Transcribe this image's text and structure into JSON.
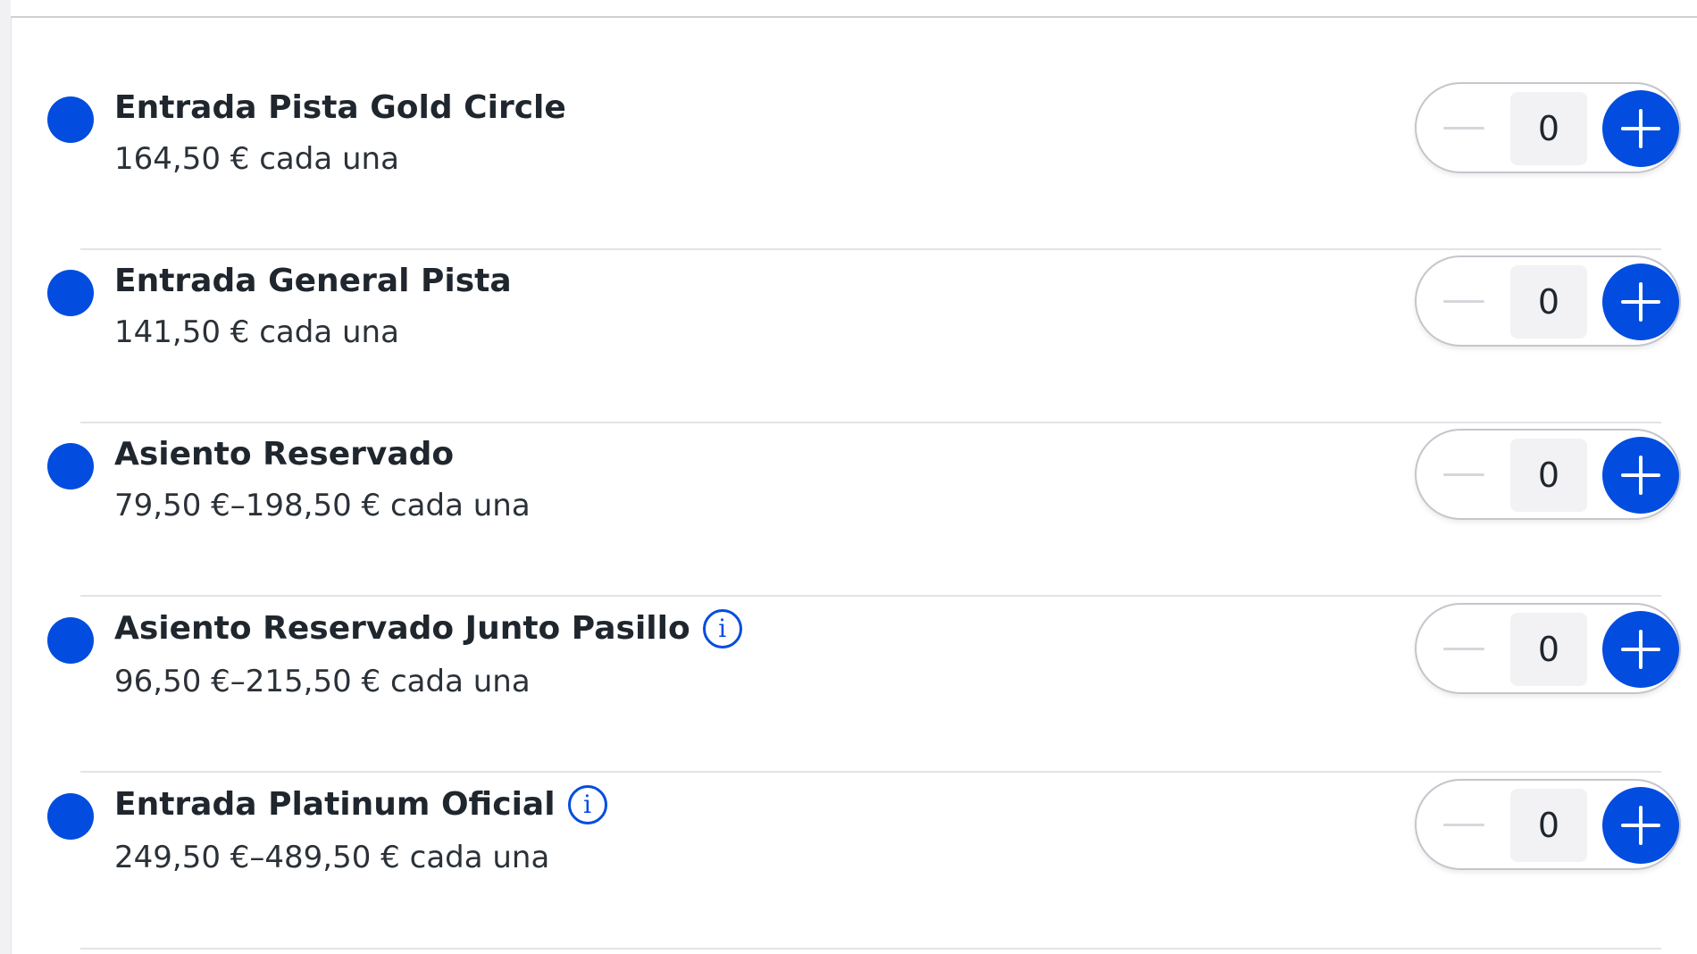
{
  "tickets": [
    {
      "name": "Entrada Pista Gold Circle",
      "price": "164,50 € cada una",
      "quantity": "0",
      "has_info": false
    },
    {
      "name": "Entrada General Pista",
      "price": "141,50 € cada una",
      "quantity": "0",
      "has_info": false
    },
    {
      "name": "Asiento Reservado",
      "price": "79,50 €–198,50 € cada una",
      "quantity": "0",
      "has_info": false
    },
    {
      "name": "Asiento Reservado Junto Pasillo",
      "price": "96,50 €–215,50 € cada una",
      "quantity": "0",
      "has_info": true
    },
    {
      "name": "Entrada Platinum Oficial",
      "price": "249,50 €–489,50 € cada una",
      "quantity": "0",
      "has_info": true
    }
  ],
  "colors": {
    "accent": "#024ddf",
    "text": "#1f262d",
    "divider": "#e3e3e8"
  },
  "icons": {
    "dot": "availability-dot",
    "info": "info-icon",
    "minus": "minus-icon",
    "plus": "plus-icon"
  }
}
